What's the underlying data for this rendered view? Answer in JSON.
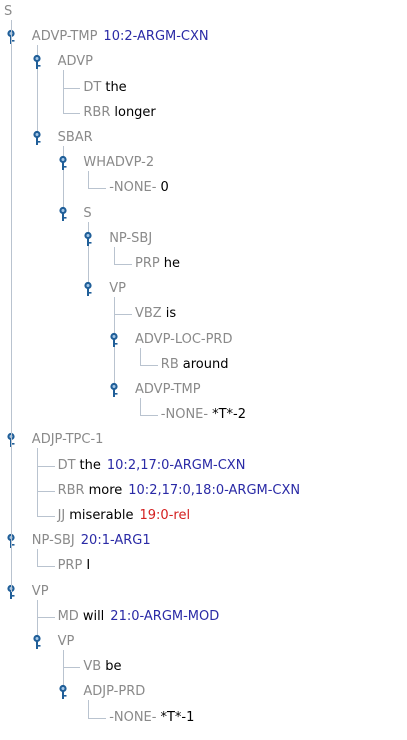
{
  "tree": [
    {
      "label": "S",
      "depth": 0,
      "expandable": false,
      "root": true
    },
    {
      "label": "ADVP-TMP",
      "ann": "10:2-ARGM-CXN",
      "depth": 1,
      "expandable": true
    },
    {
      "label": "ADVP",
      "depth": 2,
      "expandable": true
    },
    {
      "label": "DT",
      "word": "the",
      "depth": 3
    },
    {
      "label": "RBR",
      "word": "longer",
      "depth": 3
    },
    {
      "label": "SBAR",
      "depth": 2,
      "expandable": true
    },
    {
      "label": "WHADVP-2",
      "depth": 3,
      "expandable": true
    },
    {
      "label": "-NONE-",
      "word": "0",
      "depth": 4
    },
    {
      "label": "S",
      "depth": 3,
      "expandable": true
    },
    {
      "label": "NP-SBJ",
      "depth": 4,
      "expandable": true
    },
    {
      "label": "PRP",
      "word": "he",
      "depth": 5
    },
    {
      "label": "VP",
      "depth": 4,
      "expandable": true
    },
    {
      "label": "VBZ",
      "word": "is",
      "depth": 5
    },
    {
      "label": "ADVP-LOC-PRD",
      "depth": 5,
      "expandable": true
    },
    {
      "label": "RB",
      "word": "around",
      "depth": 6
    },
    {
      "label": "ADVP-TMP",
      "depth": 5,
      "expandable": true
    },
    {
      "label": "-NONE-",
      "word": "*T*-2",
      "depth": 6
    },
    {
      "label": "ADJP-TPC-1",
      "depth": 1,
      "expandable": true
    },
    {
      "label": "DT",
      "word": "the",
      "ann": "10:2,17:0-ARGM-CXN",
      "depth": 2
    },
    {
      "label": "RBR",
      "word": "more",
      "ann": "10:2,17:0,18:0-ARGM-CXN",
      "depth": 2
    },
    {
      "label": "JJ",
      "word": "miserable",
      "ann": "19:0-rel",
      "ann_red": true,
      "depth": 2
    },
    {
      "label": "NP-SBJ",
      "ann": "20:1-ARG1",
      "depth": 1,
      "expandable": true
    },
    {
      "label": "PRP",
      "word": "I",
      "depth": 2
    },
    {
      "label": "VP",
      "depth": 1,
      "expandable": true
    },
    {
      "label": "MD",
      "word": "will",
      "ann": "21:0-ARGM-MOD",
      "depth": 2
    },
    {
      "label": "VP",
      "depth": 2,
      "expandable": true
    },
    {
      "label": "VB",
      "word": "be",
      "depth": 3
    },
    {
      "label": "ADJP-PRD",
      "depth": 3,
      "expandable": true
    },
    {
      "label": "-NONE-",
      "word": "*T*-1",
      "depth": 4
    }
  ]
}
